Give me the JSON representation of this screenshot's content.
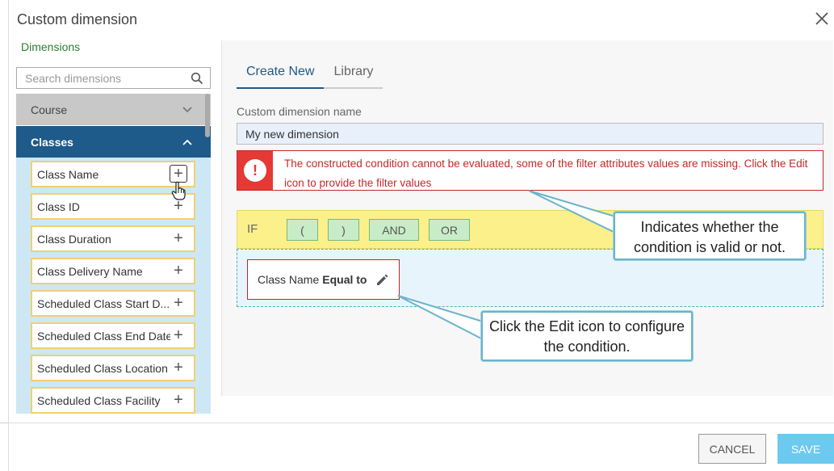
{
  "dialog": {
    "title": "Custom dimension",
    "close_icon": "close-icon"
  },
  "left": {
    "dimensions_label": "Dimensions",
    "search_placeholder": "Search dimensions",
    "search_icon": "search-icon",
    "categories": [
      {
        "label": "Course",
        "expanded": false
      },
      {
        "label": "Classes",
        "expanded": true
      }
    ],
    "items": [
      {
        "label": "Class Name"
      },
      {
        "label": "Class ID"
      },
      {
        "label": "Class Duration"
      },
      {
        "label": "Class Delivery Name"
      },
      {
        "label": "Scheduled Class Start D..."
      },
      {
        "label": "Scheduled Class End Date"
      },
      {
        "label": "Scheduled Class Location"
      },
      {
        "label": "Scheduled Class Facility"
      }
    ],
    "plus_glyph": "+"
  },
  "right": {
    "tabs": [
      {
        "label": "Create New",
        "active": true
      },
      {
        "label": "Library",
        "active": false
      }
    ],
    "name_label": "Custom dimension name",
    "name_value": "My new dimension",
    "error_icon": "!",
    "error_text": "The constructed condition cannot be evaluated, some of the filter attributes values are missing. Click the Edit icon to provide the filter values",
    "if_label": "IF",
    "operators": [
      "(",
      ")",
      "AND",
      "OR"
    ],
    "condition": {
      "field": "Class Name",
      "operator": "Equal to"
    }
  },
  "callouts": {
    "validity": "Indicates whether the condition is valid or not.",
    "edit": "Click the Edit icon to configure the condition."
  },
  "footer": {
    "cancel_label": "CANCEL",
    "save_label": "SAVE"
  },
  "colors": {
    "accent": "#1e5a8a",
    "error": "#c62828",
    "if_bar": "#fbf08a",
    "save_button": "#6cc9ef"
  }
}
